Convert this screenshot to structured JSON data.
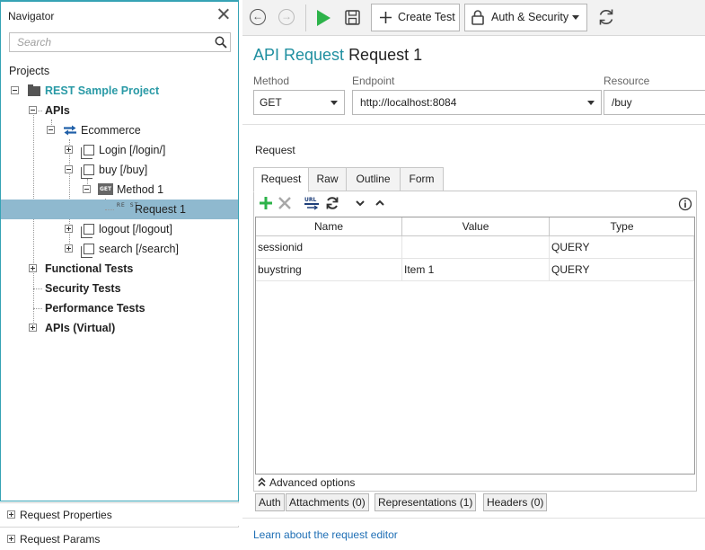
{
  "navigator": {
    "title": "Navigator",
    "search_placeholder": "Search",
    "projects_label": "Projects",
    "tree": {
      "project": "REST Sample Project",
      "apis": "APIs",
      "ecommerce": "Ecommerce",
      "login": "Login [/login/]",
      "buy": "buy [/buy]",
      "method": "Method 1",
      "request": "Request 1",
      "logout": "logout [/logout]",
      "search": "search [/search]",
      "functional_tests": "Functional Tests",
      "security_tests": "Security Tests",
      "performance_tests": "Performance Tests",
      "apis_virtual": "APIs (Virtual)"
    },
    "get_badge": "GET",
    "rest_badge": "RE ST",
    "bottom_panels": [
      "Request Properties",
      "Request Params"
    ]
  },
  "toolbar": {
    "back_glyph": "←",
    "forward_glyph": "→",
    "create_test": "Create Test",
    "auth_security": "Auth & Security"
  },
  "main": {
    "title_prefix": "API Request",
    "title_name": "Request 1",
    "method_label": "Method",
    "method_value": "GET",
    "endpoint_label": "Endpoint",
    "endpoint_value": "http://localhost:8084",
    "resource_label": "Resource",
    "resource_value": "/buy",
    "request_section": "Request",
    "tabs": [
      "Request",
      "Raw",
      "Outline",
      "Form"
    ],
    "columns": [
      "Name",
      "Value",
      "Type"
    ],
    "rows": [
      {
        "name": "sessionid",
        "value": "",
        "type": "QUERY"
      },
      {
        "name": "buystring",
        "value": "Item 1",
        "type": "QUERY"
      }
    ],
    "advanced_options": "Advanced options",
    "bottom_tabs": [
      "Auth",
      "Attachments (0)",
      "Representations (1)",
      "Headers (0)"
    ],
    "learn_link": "Learn about the request editor"
  },
  "colors": {
    "accent": "#1f8fa0",
    "selection": "#8fb9cf",
    "play_green": "#2db34a",
    "link": "#1f6fb5"
  }
}
